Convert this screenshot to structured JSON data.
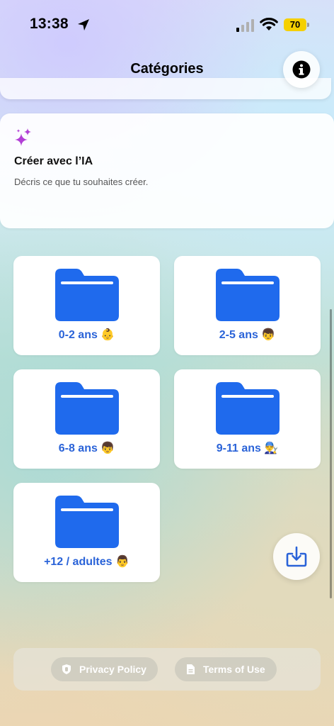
{
  "status_bar": {
    "time": "13:38",
    "battery_level": "70",
    "battery_color": "#f5d000"
  },
  "header": {
    "title": "Catégories",
    "info_icon": "info-circle-icon"
  },
  "ai_card": {
    "icon": "sparkles-icon",
    "title": "Créer avec l’IA",
    "description": "Décris ce que tu souhaites créer."
  },
  "categories": [
    {
      "label": "0-2 ans",
      "emoji": "👶",
      "icon": "folder-icon"
    },
    {
      "label": "2-5 ans",
      "emoji": "👦",
      "icon": "folder-icon"
    },
    {
      "label": "6-8 ans",
      "emoji": "👦",
      "icon": "folder-icon"
    },
    {
      "label": "9-11 ans",
      "emoji": "👨‍🔧",
      "icon": "folder-icon"
    },
    {
      "label": "+12 / adultes",
      "emoji": "👨",
      "icon": "folder-icon"
    }
  ],
  "fab": {
    "icon": "download-icon"
  },
  "footer": {
    "privacy_label": "Privacy Policy",
    "terms_label": "Terms of Use"
  },
  "colors": {
    "accent": "#2a63d8",
    "folder": "#1f6aed",
    "sparkle": "#b23fd6"
  }
}
